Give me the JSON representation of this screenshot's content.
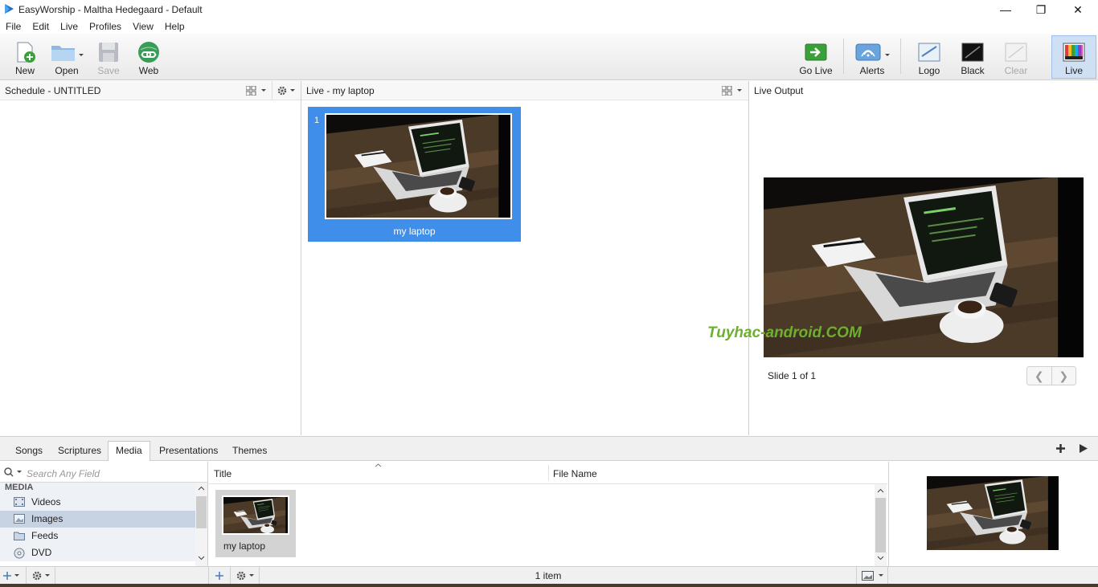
{
  "window": {
    "title": "EasyWorship - Maltha Hedegaard - Default",
    "controls": {
      "minimize": "—",
      "restore": "❐",
      "close": "✕"
    }
  },
  "menu": [
    "File",
    "Edit",
    "Live",
    "Profiles",
    "View",
    "Help"
  ],
  "toolbar": {
    "new_label": "New",
    "open_label": "Open",
    "save_label": "Save",
    "web_label": "Web",
    "golive_label": "Go Live",
    "alerts_label": "Alerts",
    "logo_label": "Logo",
    "black_label": "Black",
    "clear_label": "Clear",
    "live_label": "Live"
  },
  "schedule": {
    "title": "Schedule - UNTITLED"
  },
  "live": {
    "title": "Live - my laptop",
    "slides": [
      {
        "number": "1",
        "caption": "my laptop"
      }
    ]
  },
  "live_output": {
    "title": "Live Output",
    "slide_counter": "Slide 1 of 1",
    "prev": "❮",
    "next": "❯"
  },
  "watermark": "Tuyhac-android.COM",
  "library": {
    "tabs": [
      "Songs",
      "Scriptures",
      "Media",
      "Presentations",
      "Themes"
    ],
    "active_tab": "Media",
    "search_placeholder": "Search Any Field",
    "tree_header": "MEDIA",
    "tree_items": [
      "Videos",
      "Images",
      "Feeds",
      "DVD"
    ],
    "selected_tree_item": "Images",
    "columns": [
      "Title",
      "File Name"
    ],
    "items": [
      {
        "caption": "my laptop"
      }
    ],
    "item_count": "1 item"
  },
  "colors": {
    "selection_blue": "#3f8fea",
    "tree_selected": "#c7d3e3",
    "live_active": "#cfe0f4",
    "watermark_green": "#6db02d"
  }
}
